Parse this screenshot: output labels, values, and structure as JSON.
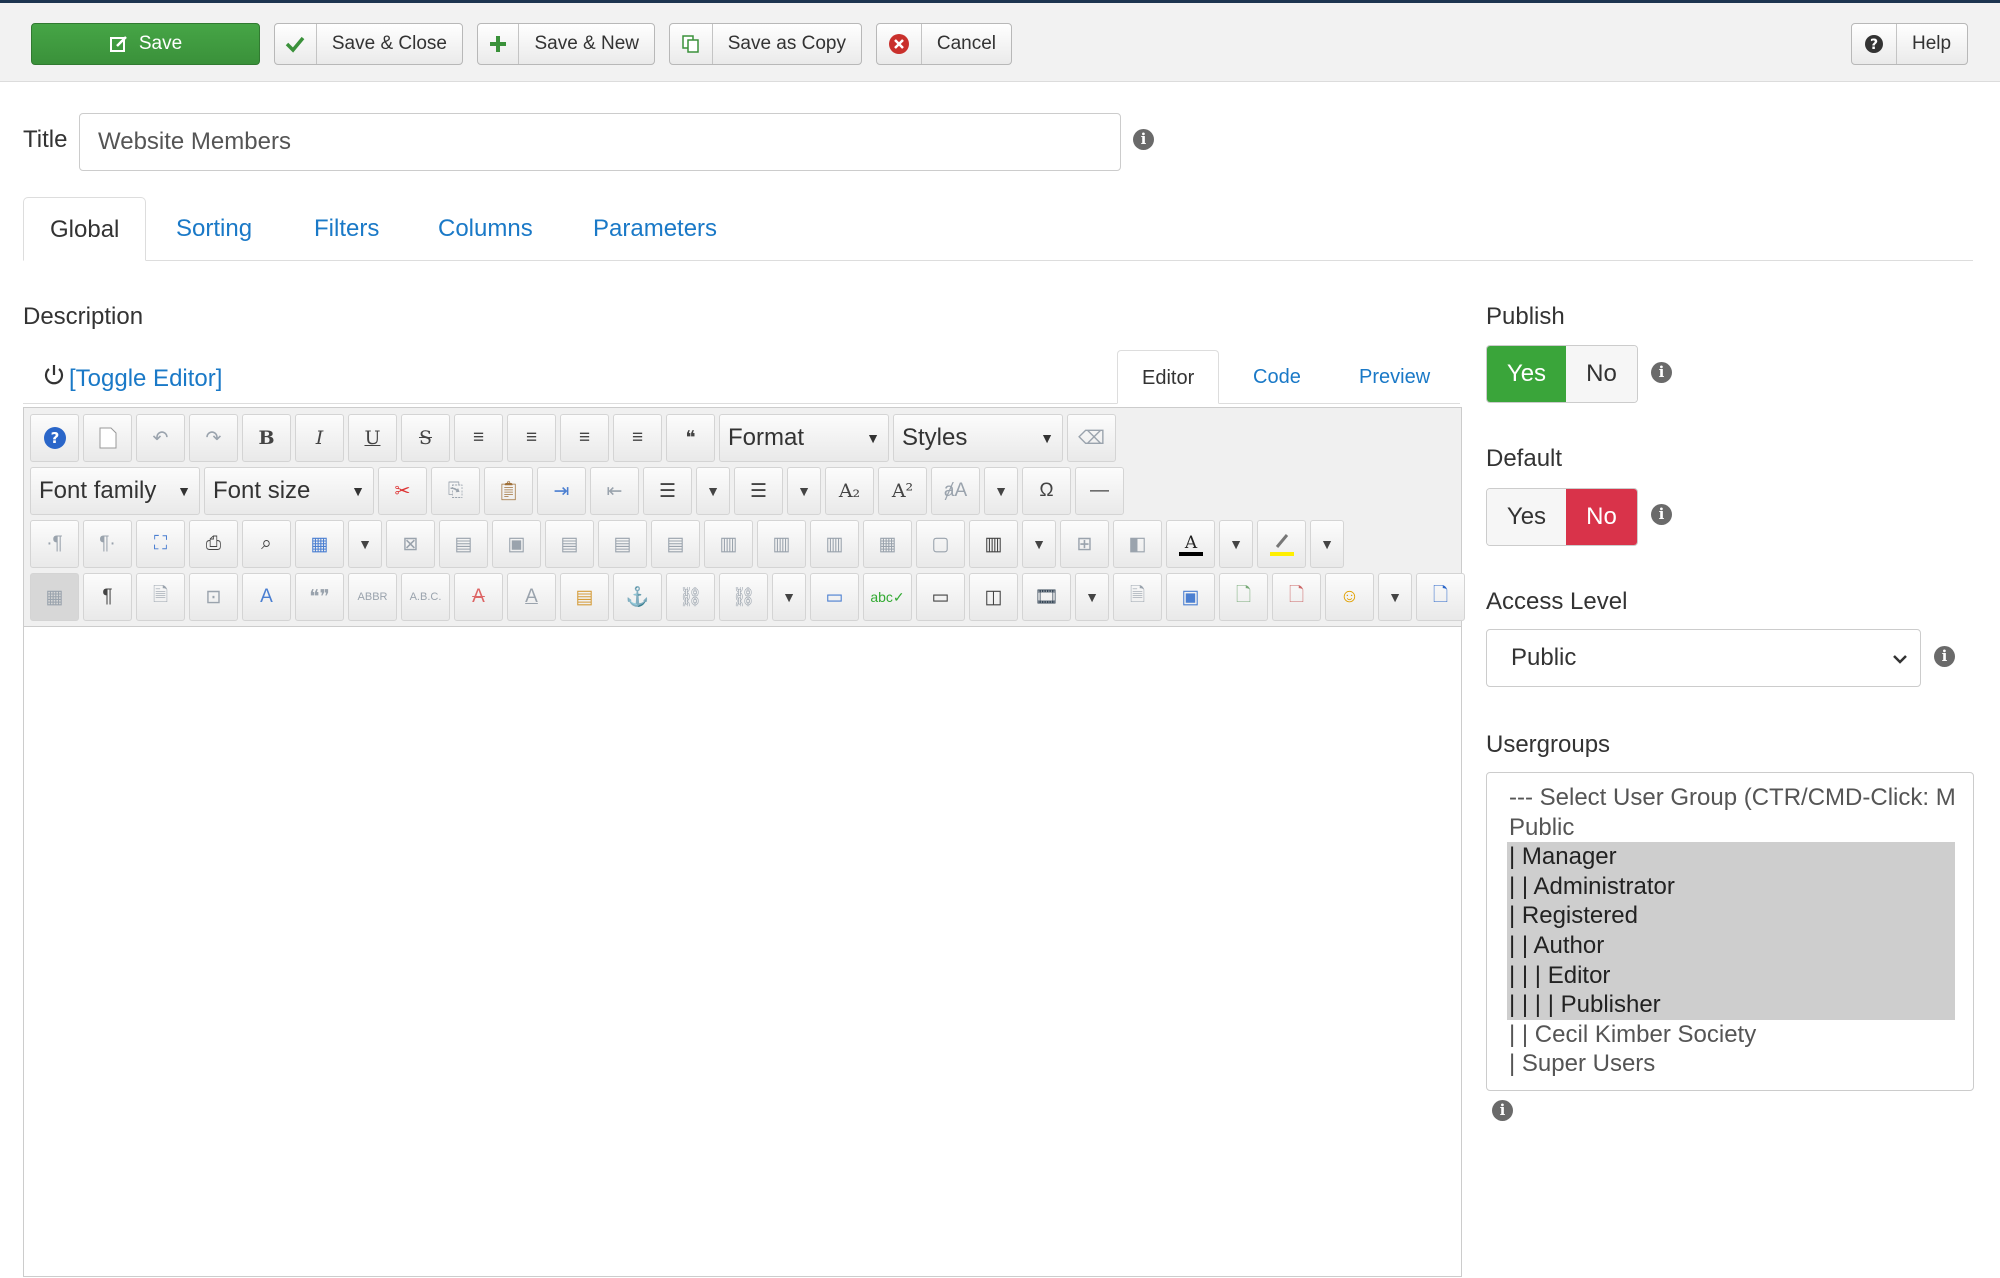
{
  "toolbar": {
    "save": "Save",
    "save_close": "Save & Close",
    "save_new": "Save & New",
    "save_copy": "Save as Copy",
    "cancel": "Cancel",
    "help": "Help"
  },
  "title": {
    "label": "Title",
    "value": "Website Members"
  },
  "tabs": [
    "Global",
    "Sorting",
    "Filters",
    "Columns",
    "Parameters"
  ],
  "description": {
    "label": "Description",
    "toggle_editor": "[Toggle Editor]",
    "editor_tabs": [
      "Editor",
      "Code",
      "Preview"
    ],
    "format": "Format",
    "styles": "Styles",
    "font_family": "Font family",
    "font_size": "Font size"
  },
  "publish": {
    "label": "Publish",
    "yes": "Yes",
    "no": "No",
    "value": "Yes"
  },
  "default": {
    "label": "Default",
    "yes": "Yes",
    "no": "No",
    "value": "No"
  },
  "access_level": {
    "label": "Access Level",
    "value": "Public"
  },
  "usergroups": {
    "label": "Usergroups",
    "options": [
      {
        "text": "--- Select User Group (CTR/CMD-Click: M",
        "selected": false
      },
      {
        "text": "Public",
        "selected": false
      },
      {
        "text": "| Manager",
        "selected": true
      },
      {
        "text": "| | Administrator",
        "selected": true
      },
      {
        "text": "| Registered",
        "selected": true
      },
      {
        "text": "| | Author",
        "selected": true
      },
      {
        "text": "| | | Editor",
        "selected": true
      },
      {
        "text": "| | | | Publisher",
        "selected": true
      },
      {
        "text": "| | Cecil Kimber Society",
        "selected": false
      },
      {
        "text": "| Super Users",
        "selected": false
      }
    ]
  },
  "colors": {
    "primary": "#1a79c7",
    "success": "#3aa53a",
    "danger": "#d9334a",
    "header": "#1d3550"
  }
}
